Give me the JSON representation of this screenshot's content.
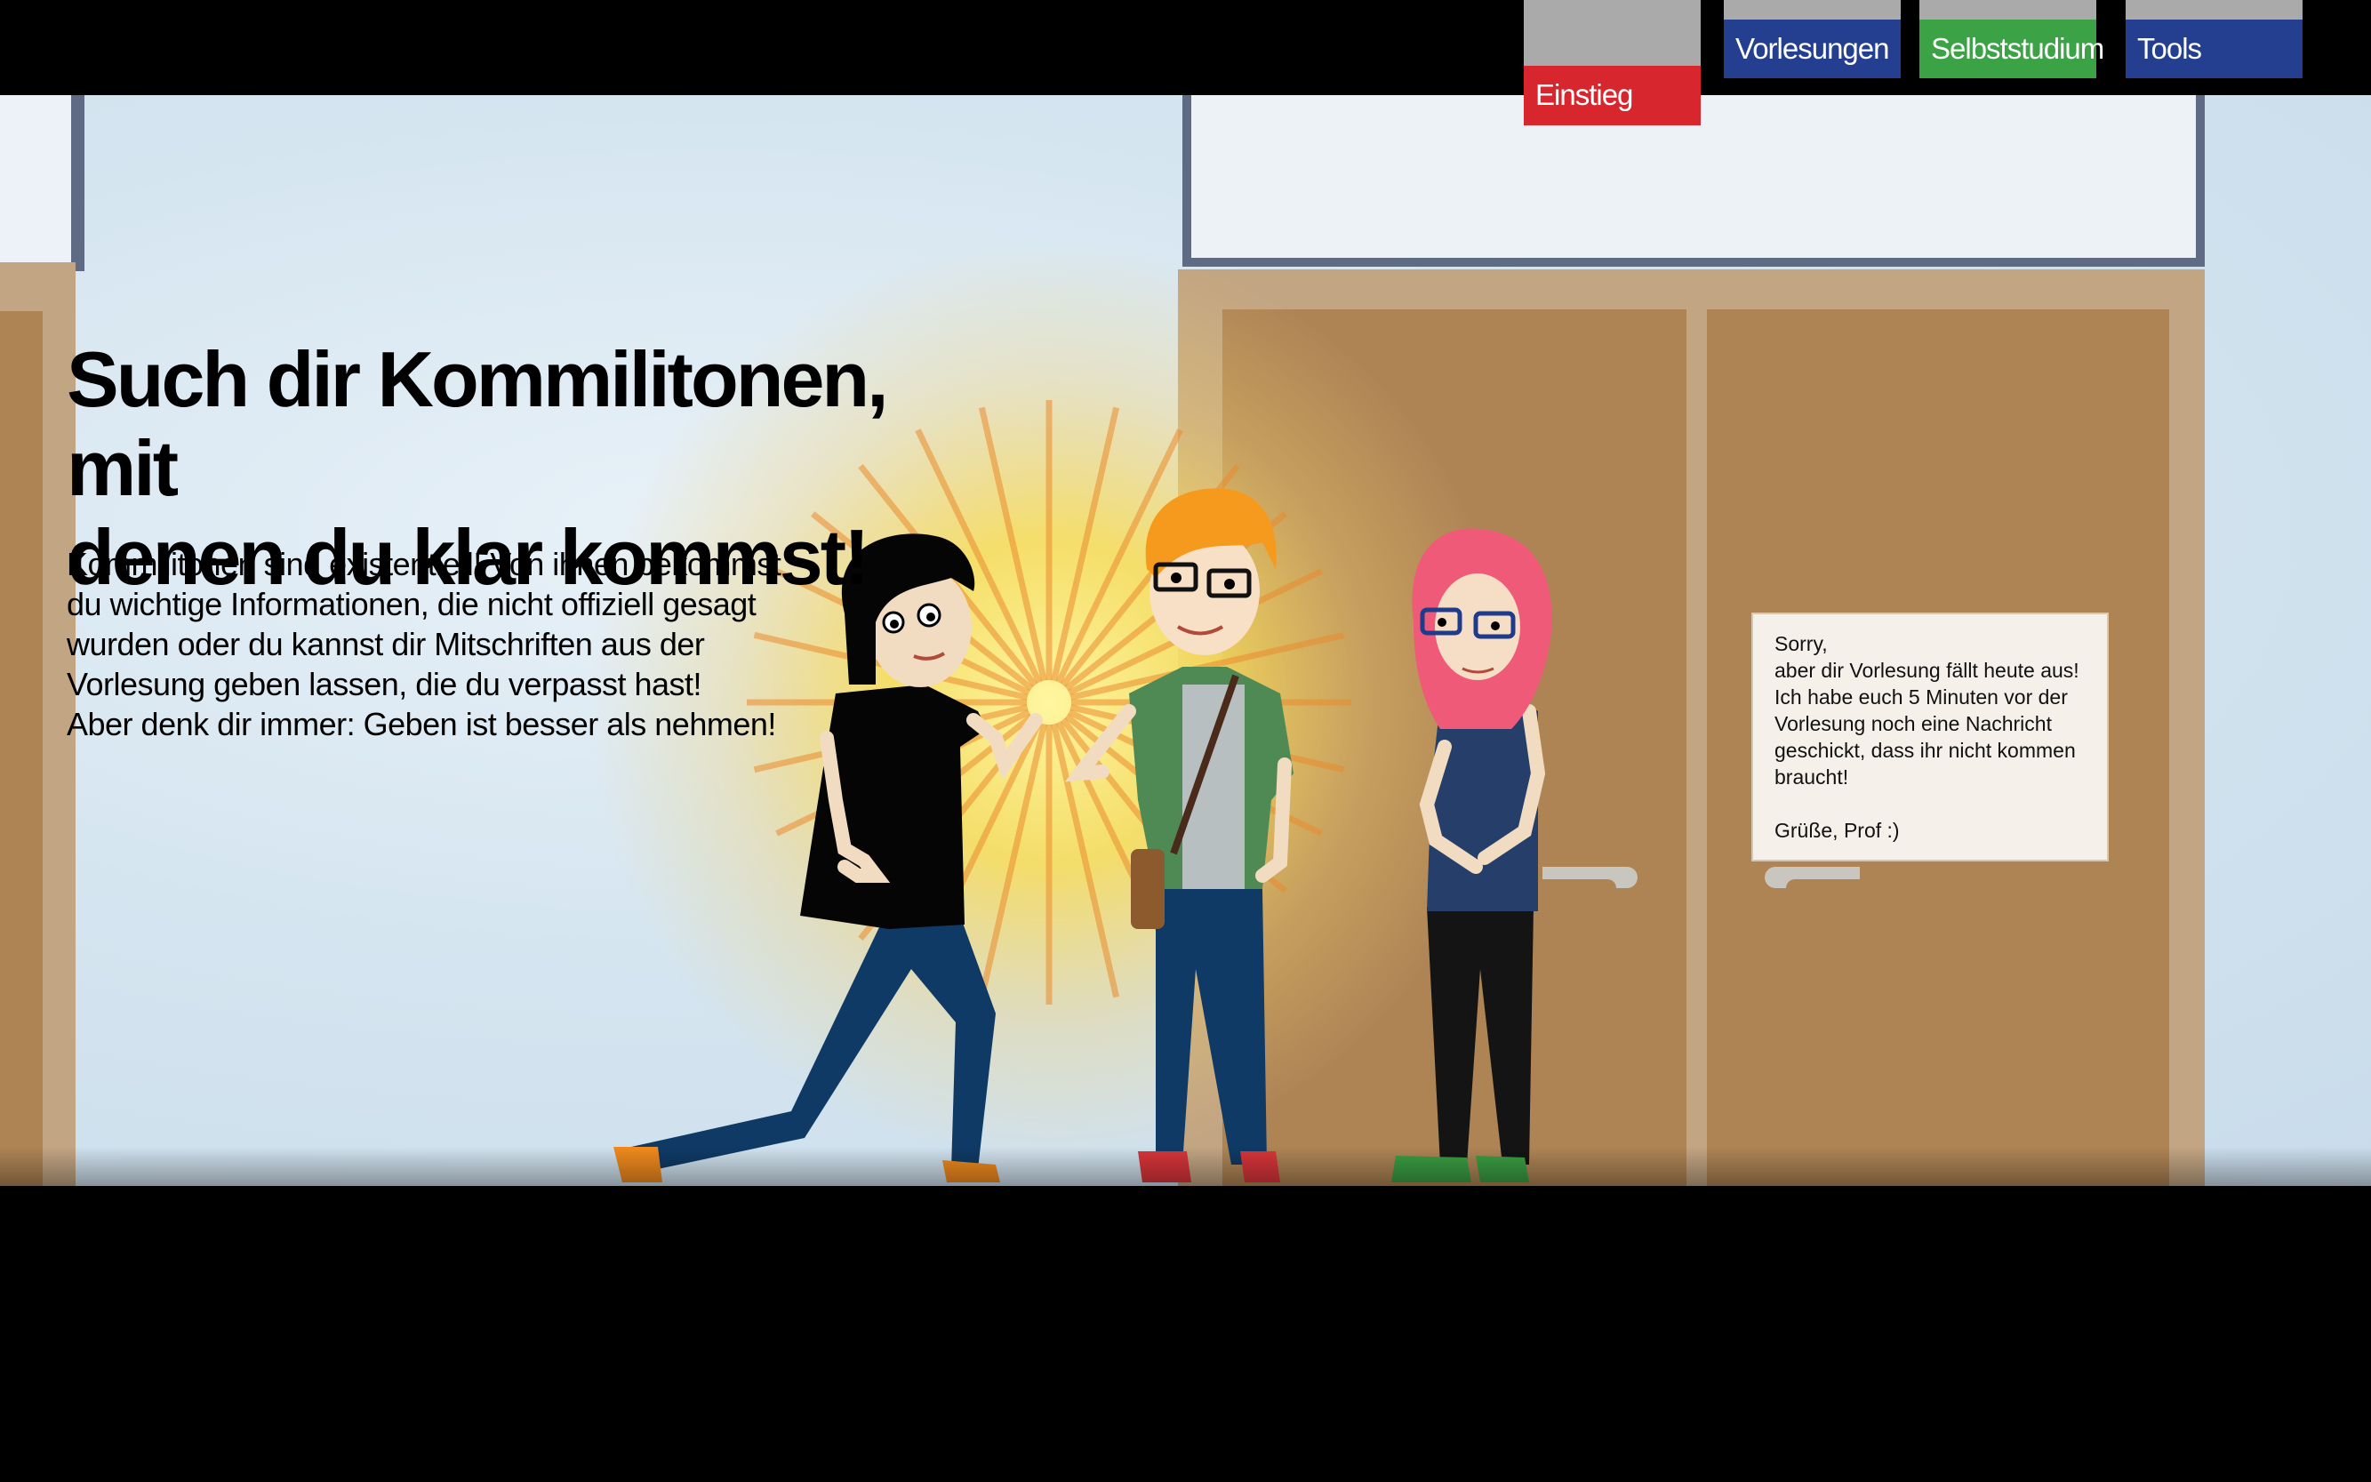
{
  "nav": {
    "tabs": [
      {
        "label": "Einstieg",
        "color": "#d7262e",
        "active": true
      },
      {
        "label": "Vorlesungen",
        "color": "#243f8f",
        "active": false
      },
      {
        "label": "Selbststudium",
        "color": "#3ba345",
        "active": false
      },
      {
        "label": "Tools",
        "color": "#243f8f",
        "active": false
      }
    ]
  },
  "main": {
    "headline_lines": [
      "Such dir Kommilitonen, mit",
      "denen du klar kommst!"
    ],
    "intro_lines": [
      "Kommilitonen sind existentiell! Von ihnen bekommst",
      "du wichtige Informationen, die nicht offiziell gesagt",
      "wurden oder du kannst dir Mitschriften aus der",
      "Vorlesung geben lassen, die du verpasst hast!",
      "Aber denk dir immer: Geben ist besser als nehmen!"
    ]
  },
  "note": {
    "lines": [
      "Sorry,",
      "aber dir Vorlesung fällt heute aus!",
      "Ich habe euch 5 Minuten vor der",
      "Vorlesung noch eine Nachricht",
      "geschickt, dass ihr nicht kommen",
      "braucht!",
      "",
      "Grüße, Prof :)"
    ]
  },
  "colors": {
    "door": "#ae8455",
    "door_frame": "#c2a583",
    "window_frame": "#5f6b85",
    "sky": "#d5e5f0",
    "burst": "#f5d93a"
  }
}
